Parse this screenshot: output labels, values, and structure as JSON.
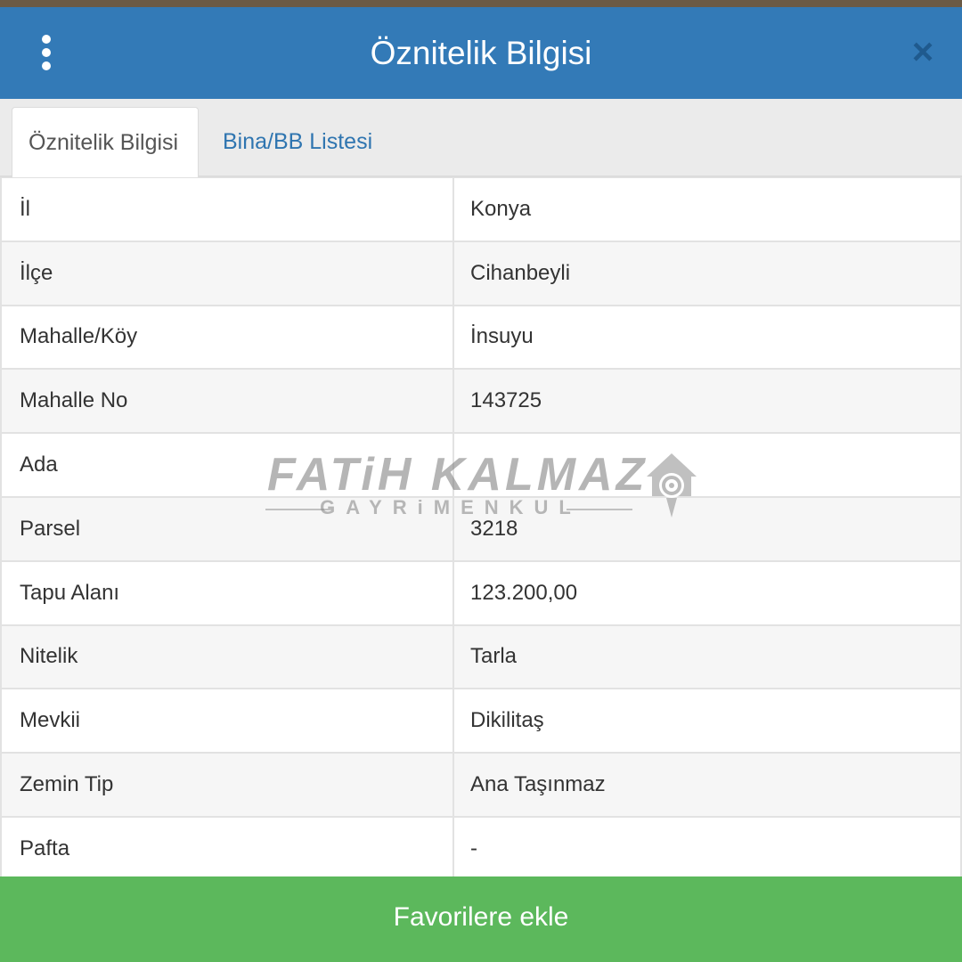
{
  "header": {
    "title": "Öznitelik Bilgisi",
    "close_label": "×"
  },
  "tabs": [
    {
      "label": "Öznitelik Bilgisi",
      "active": true
    },
    {
      "label": "Bina/BB Listesi",
      "active": false
    }
  ],
  "attributes": [
    {
      "key": "İl",
      "value": "Konya"
    },
    {
      "key": "İlçe",
      "value": "Cihanbeyli"
    },
    {
      "key": "Mahalle/Köy",
      "value": "İnsuyu"
    },
    {
      "key": "Mahalle No",
      "value": "143725"
    },
    {
      "key": "Ada",
      "value": ""
    },
    {
      "key": "Parsel",
      "value": "3218"
    },
    {
      "key": "Tapu Alanı",
      "value": "123.200,00"
    },
    {
      "key": "Nitelik",
      "value": "Tarla"
    },
    {
      "key": "Mevkii",
      "value": "Dikilitaş"
    },
    {
      "key": "Zemin Tip",
      "value": "Ana Taşınmaz"
    },
    {
      "key": "Pafta",
      "value": "-"
    }
  ],
  "watermark": {
    "name": "FATiH KALMAZ",
    "subtitle": "GAYRiMENKUL"
  },
  "footer": {
    "button_label": "Favorilere ekle"
  },
  "colors": {
    "header": "#337ab7",
    "tab_link": "#2f75b0",
    "footer_button": "#5cb85c"
  }
}
